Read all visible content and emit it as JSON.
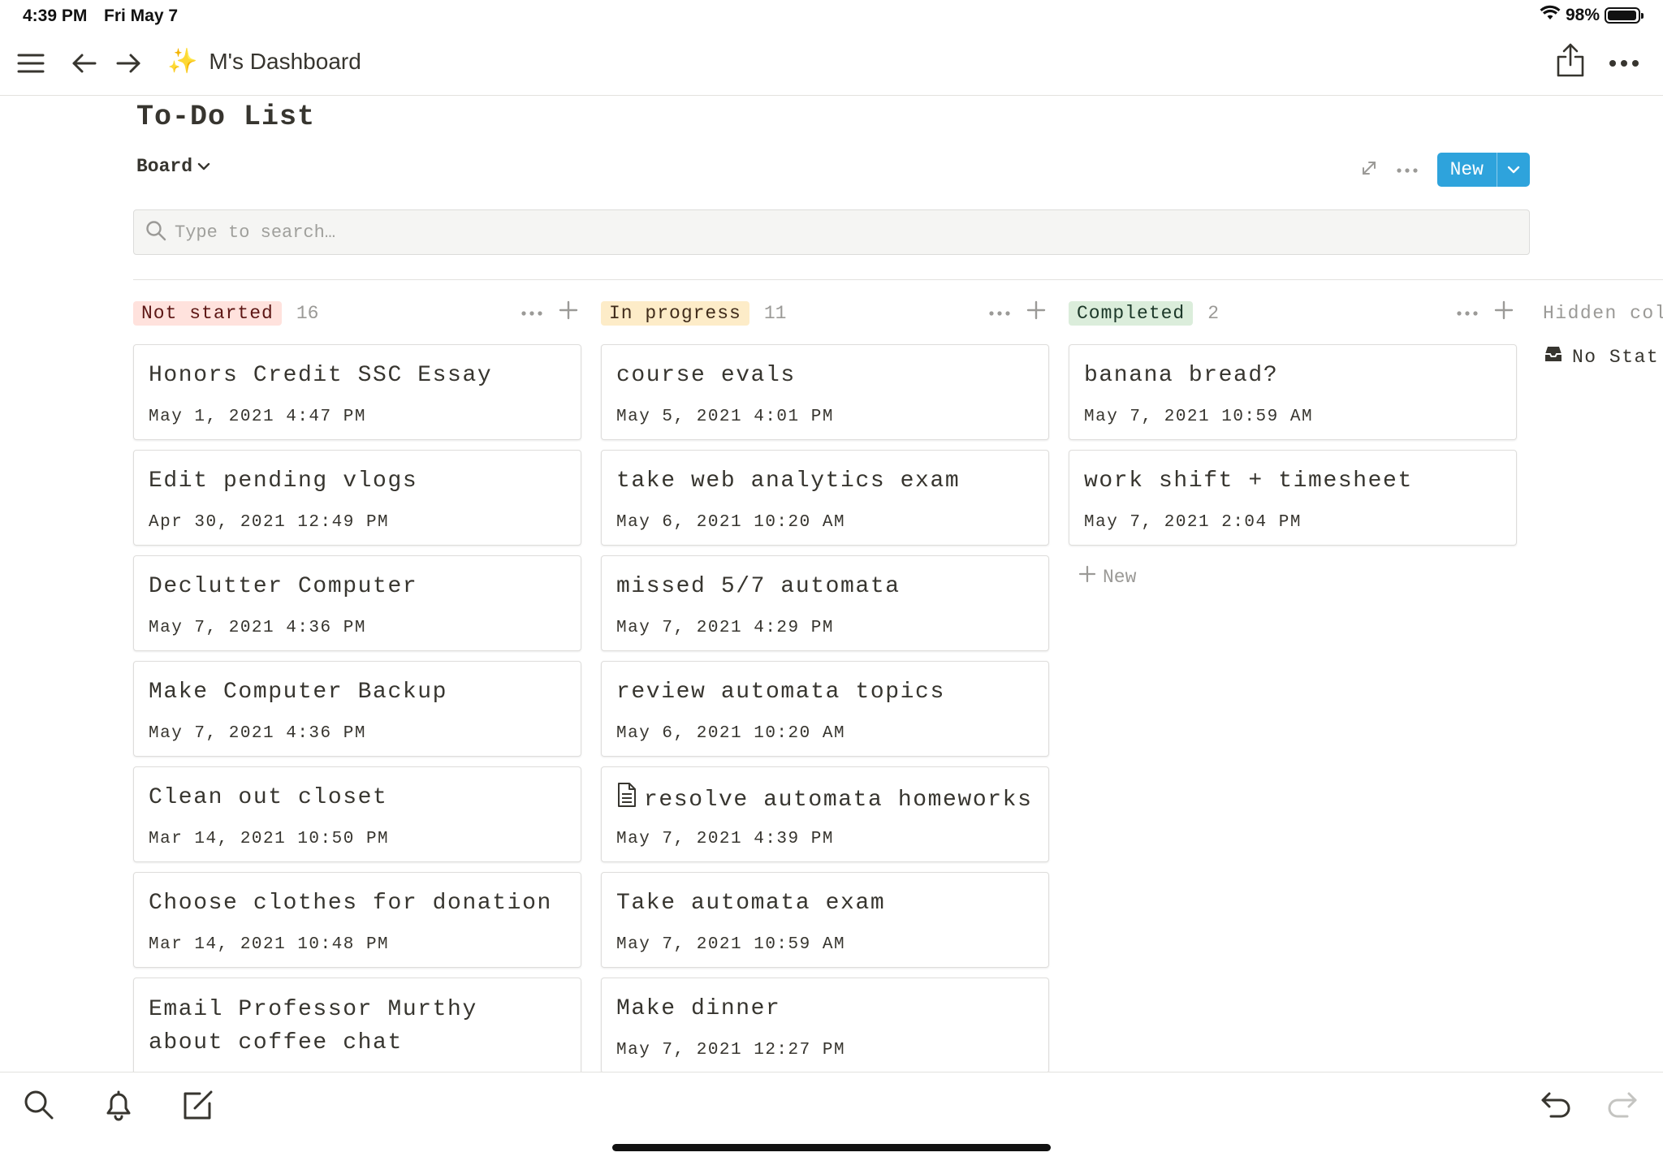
{
  "status_bar": {
    "time": "4:39 PM",
    "date": "Fri May 7",
    "battery": "98%",
    "battery_level": 0.98
  },
  "toolbar": {
    "breadcrumb_title": "M's Dashboard",
    "icons": [
      "menu-icon",
      "back-arrow-icon",
      "forward-arrow-icon",
      "sparkles-icon",
      "share-icon",
      "more-icon"
    ]
  },
  "page": {
    "title": "To-Do List",
    "view": "Board",
    "new_label": "New",
    "search_placeholder": "Type to search…"
  },
  "columns": [
    {
      "label": "Not started",
      "count": "16",
      "tag_bg": "#ffe2dd",
      "tag_color": "#5d1715",
      "cards": [
        {
          "title": "Honors Credit SSC Essay",
          "date": "May 1, 2021 4:47 PM"
        },
        {
          "title": "Edit pending vlogs",
          "date": "Apr 30, 2021 12:49 PM"
        },
        {
          "title": "Declutter Computer",
          "date": "May 7, 2021 4:36 PM"
        },
        {
          "title": "Make Computer Backup",
          "date": "May 7, 2021 4:36 PM"
        },
        {
          "title": "Clean out closet",
          "date": "Mar 14, 2021 10:50 PM"
        },
        {
          "title": "Choose clothes for donation",
          "date": "Mar 14, 2021 10:48 PM"
        },
        {
          "title": "Email Professor Murthy about coffee chat",
          "date": ""
        }
      ]
    },
    {
      "label": "In progress",
      "count": "11",
      "tag_bg": "#fdecc8",
      "tag_color": "#402c1b",
      "cards": [
        {
          "title": "course evals",
          "date": "May 5, 2021 4:01 PM"
        },
        {
          "title": "take web analytics exam",
          "date": "May 6, 2021 10:20 AM"
        },
        {
          "title": "missed 5/7 automata",
          "date": "May 7, 2021 4:29 PM"
        },
        {
          "title": "review automata topics",
          "date": "May 6, 2021 10:20 AM"
        },
        {
          "title": "resolve automata homeworks",
          "date": "May 7, 2021 4:39 PM",
          "icon": "document-icon"
        },
        {
          "title": "Take automata exam",
          "date": "May 7, 2021 10:59 AM"
        },
        {
          "title": "Make dinner",
          "date": "May 7, 2021 12:27 PM"
        }
      ]
    },
    {
      "label": "Completed",
      "count": "2",
      "tag_bg": "#dbeddb",
      "tag_color": "#1c3829",
      "cards": [
        {
          "title": "banana bread?",
          "date": "May 7, 2021 10:59 AM"
        },
        {
          "title": "work shift + timesheet",
          "date": "May 7, 2021 2:04 PM"
        }
      ],
      "new_label": "New"
    }
  ],
  "hidden": {
    "header": "Hidden col",
    "item": "No Stat"
  },
  "bottom_bar": {
    "icons": [
      "search-icon",
      "bell-icon",
      "compose-icon",
      "undo-icon",
      "redo-icon"
    ]
  }
}
